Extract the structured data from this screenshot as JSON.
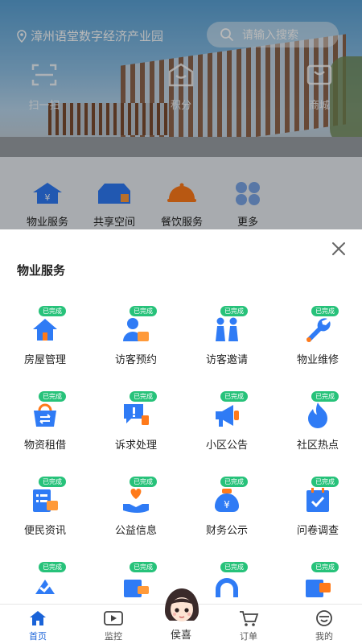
{
  "location": {
    "name": "漳州语堂数字经济产业园"
  },
  "search": {
    "placeholder": "请输入搜索"
  },
  "quick_actions": [
    {
      "label": "扫一扫",
      "icon": "scan-icon"
    },
    {
      "label": "积分",
      "icon": "points-icon"
    },
    {
      "label": "商城",
      "icon": "mall-icon"
    }
  ],
  "services": [
    {
      "label": "物业服务",
      "icon": "property-service-icon"
    },
    {
      "label": "共享空间",
      "icon": "shared-space-icon"
    },
    {
      "label": "餐饮服务",
      "icon": "catering-icon"
    },
    {
      "label": "更多",
      "icon": "more-icon"
    }
  ],
  "sheet": {
    "title": "物业服务",
    "badge": "已完成",
    "items": [
      {
        "label": "房屋管理",
        "icon": "house-icon"
      },
      {
        "label": "访客预约",
        "icon": "visitor-booking-icon"
      },
      {
        "label": "访客邀请",
        "icon": "visitor-invite-icon"
      },
      {
        "label": "物业维修",
        "icon": "repair-icon"
      },
      {
        "label": "物资租借",
        "icon": "rental-icon"
      },
      {
        "label": "诉求处理",
        "icon": "complaint-icon"
      },
      {
        "label": "小区公告",
        "icon": "announcement-icon"
      },
      {
        "label": "社区热点",
        "icon": "hot-topic-icon"
      },
      {
        "label": "便民资讯",
        "icon": "news-icon"
      },
      {
        "label": "公益信息",
        "icon": "charity-icon"
      },
      {
        "label": "财务公示",
        "icon": "finance-icon"
      },
      {
        "label": "问卷调查",
        "icon": "survey-icon"
      }
    ]
  },
  "tabbar": {
    "items": [
      {
        "label": "首页",
        "icon": "home-icon",
        "active": true
      },
      {
        "label": "监控",
        "icon": "monitor-icon",
        "active": false
      },
      {
        "label": "侯喜",
        "icon": "mascot-avatar",
        "active": false
      },
      {
        "label": "订单",
        "icon": "cart-icon",
        "active": false
      },
      {
        "label": "我的",
        "icon": "profile-icon",
        "active": false
      }
    ]
  },
  "colors": {
    "accent": "#1a63d8",
    "badge": "#27c27a",
    "icon_blue": "#2f7bf5",
    "icon_orange": "#ff7a1a"
  }
}
